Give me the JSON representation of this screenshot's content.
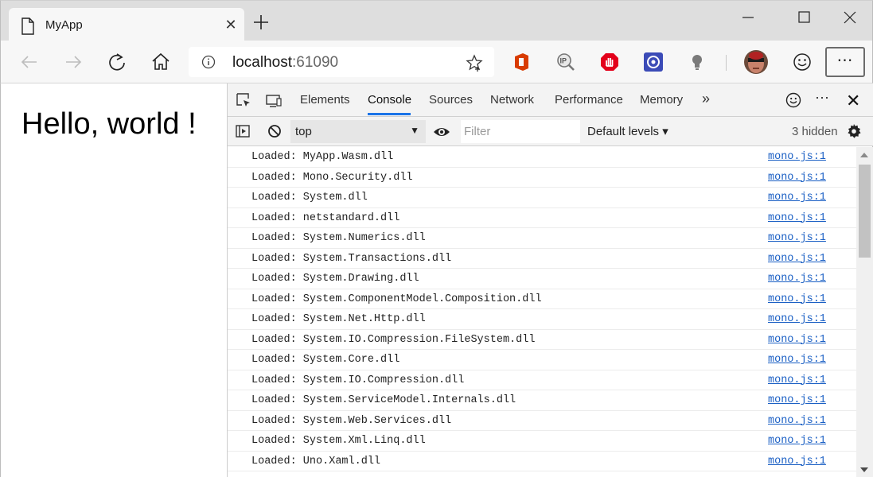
{
  "browser": {
    "tab": {
      "title": "MyApp",
      "close_glyph": "✕",
      "icon": "page-icon"
    },
    "new_tab_icon": "plus-icon",
    "window_controls": [
      "minimize-icon",
      "maximize-icon",
      "close-icon"
    ],
    "address": {
      "host": "localhost",
      "port": ":61090",
      "info_icon": "info-icon",
      "favorite_icon": "star-icon"
    },
    "nav_icons": [
      "back-arrow-icon",
      "forward-arrow-icon",
      "refresh-icon",
      "home-icon"
    ],
    "extensions": [
      "office-icon",
      "ip-lookup-icon",
      "adblock-icon",
      "circle-extension-icon",
      "lightbulb-icon"
    ],
    "emoji_icon": "smiley-icon",
    "more_label": "⋯"
  },
  "page": {
    "heading": "Hello, world !"
  },
  "devtools": {
    "tabs": [
      "Elements",
      "Console",
      "Sources",
      "Network",
      "Performance",
      "Memory"
    ],
    "active_tab": "Console",
    "more_tabs_label": "»",
    "menu_label": "⋯",
    "close_label": "✕",
    "toolbar": {
      "context": "top",
      "filter_placeholder": "Filter",
      "levels": "Default levels ▾",
      "hidden": "3 hidden"
    },
    "accent": "#1a73e8",
    "log_source": "mono.js:1",
    "logs": [
      "Loaded: MyApp.Wasm.dll",
      "Loaded: Mono.Security.dll",
      "Loaded: System.dll",
      "Loaded: netstandard.dll",
      "Loaded: System.Numerics.dll",
      "Loaded: System.Transactions.dll",
      "Loaded: System.Drawing.dll",
      "Loaded: System.ComponentModel.Composition.dll",
      "Loaded: System.Net.Http.dll",
      "Loaded: System.IO.Compression.FileSystem.dll",
      "Loaded: System.Core.dll",
      "Loaded: System.IO.Compression.dll",
      "Loaded: System.ServiceModel.Internals.dll",
      "Loaded: System.Web.Services.dll",
      "Loaded: System.Xml.Linq.dll",
      "Loaded: Uno.Xaml.dll"
    ]
  }
}
